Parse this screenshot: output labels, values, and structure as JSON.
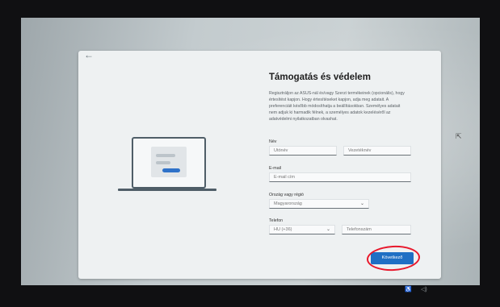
{
  "page": {
    "title": "Támogatás és védelem",
    "description": "Regisztráljon az ASUS-nál és/vagy Szerzi termékeinek (opcionális), hogy értesítést kapjon. Hogy értesítéseket kapjon, adja meg adatait. A preferenciáit később módosíthatja a beállításokban. Személyes adatait nem adjuk ki harmadik félnek, a személyes adatok kezeléséről az adatvédelmi nyilatkozatban olvashat."
  },
  "form": {
    "name_label": "Név",
    "first_name_placeholder": "Utónév",
    "last_name_placeholder": "Vezetéknév",
    "email_label": "E-mail",
    "email_placeholder": "E-mail cím",
    "country_label": "Ország vagy régió",
    "country_value": "Magyarország",
    "phone_label": "Telefon",
    "phone_code": "HU (+36)",
    "phone_placeholder": "Telefonszám",
    "next_button": "Következő"
  },
  "nav": {
    "back_icon": "←"
  },
  "taskbar": {
    "accessibility_icon": "♿",
    "volume_icon": "◁)"
  },
  "annotation": {
    "circle_color": "#e8182c"
  },
  "colors": {
    "accent": "#1f6fc4"
  }
}
